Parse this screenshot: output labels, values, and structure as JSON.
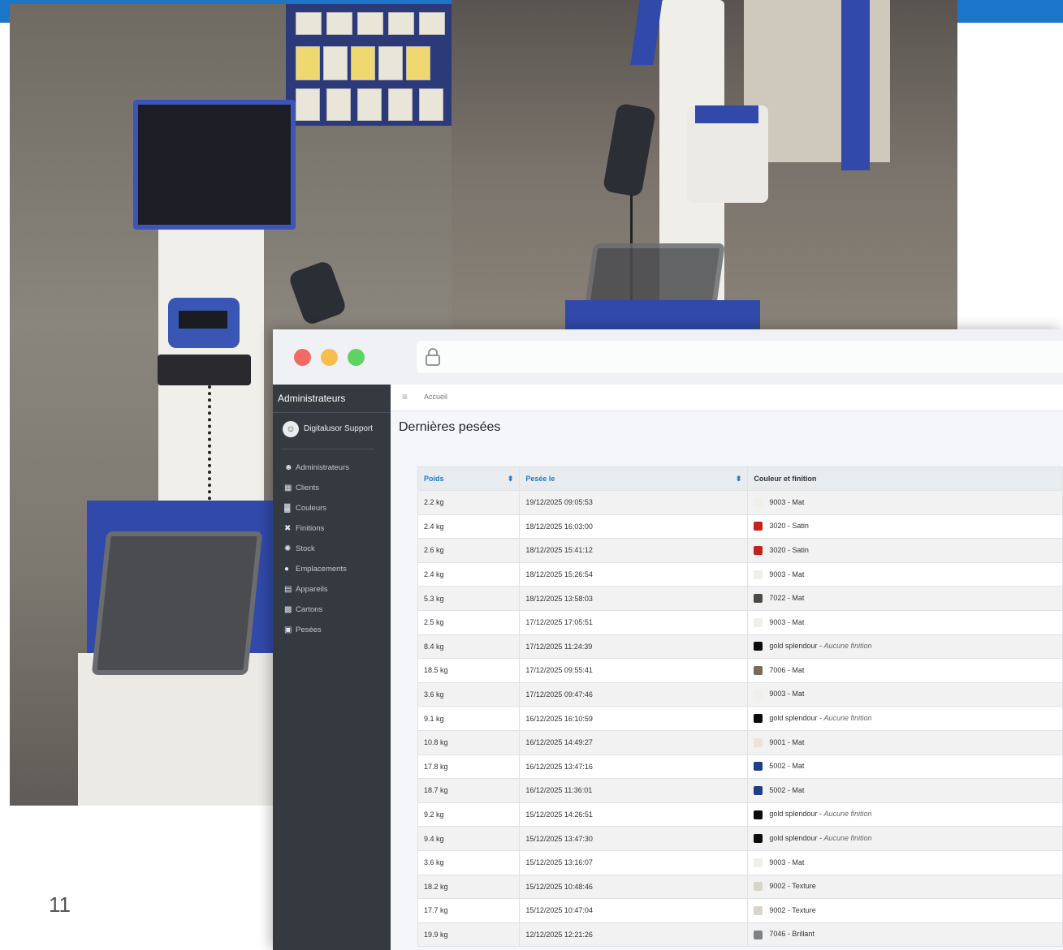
{
  "slide": {
    "number": "11"
  },
  "browser": {
    "sidebar": {
      "brand": "Administrateurs",
      "user": "Digitalusor Support",
      "items": [
        {
          "label": "Administrateurs",
          "icon": "users-icon"
        },
        {
          "label": "Clients",
          "icon": "building-icon"
        },
        {
          "label": "Couleurs",
          "icon": "palette-swatch-icon"
        },
        {
          "label": "Finitions",
          "icon": "tools-icon"
        },
        {
          "label": "Stock",
          "icon": "palette-icon"
        },
        {
          "label": "Emplacements",
          "icon": "map-marker-icon"
        },
        {
          "label": "Appareils",
          "icon": "device-icon"
        },
        {
          "label": "Cartons",
          "icon": "boxes-icon"
        },
        {
          "label": "Pesées",
          "icon": "scale-icon"
        }
      ]
    },
    "breadcrumb": "Accueil",
    "page_title": "Dernières pesées",
    "table": {
      "headers": [
        "Poids",
        "Pesée le",
        "Couleur et finition"
      ],
      "rows": [
        {
          "poids": "2.2 kg",
          "date": "19/12/2025 09:05:53",
          "color": "9003 - Mat",
          "swatch": "#f0efea",
          "note": ""
        },
        {
          "poids": "2.4 kg",
          "date": "18/12/2025 16:03:00",
          "color": "3020 - Satin",
          "swatch": "#c7211f",
          "note": ""
        },
        {
          "poids": "2.6 kg",
          "date": "18/12/2025 15:41:12",
          "color": "3020 - Satin",
          "swatch": "#c7211f",
          "note": ""
        },
        {
          "poids": "2.4 kg",
          "date": "18/12/2025 15:26:54",
          "color": "9003 - Mat",
          "swatch": "#f0efea",
          "note": ""
        },
        {
          "poids": "5.3 kg",
          "date": "18/12/2025 13:58:03",
          "color": "7022 - Mat",
          "swatch": "#4c4a45",
          "note": ""
        },
        {
          "poids": "2.5 kg",
          "date": "17/12/2025 17:05:51",
          "color": "9003 - Mat",
          "swatch": "#f0efea",
          "note": ""
        },
        {
          "poids": "8.4 kg",
          "date": "17/12/2025 11:24:39",
          "color": "gold splendour",
          "swatch": "#0b0b0b",
          "note": "Aucune finition"
        },
        {
          "poids": "18.5 kg",
          "date": "17/12/2025 09:55:41",
          "color": "7006 - Mat",
          "swatch": "#7a6a5c",
          "note": ""
        },
        {
          "poids": "3.6 kg",
          "date": "17/12/2025 09:47:46",
          "color": "9003 - Mat",
          "swatch": "#f0efea",
          "note": ""
        },
        {
          "poids": "9.1 kg",
          "date": "16/12/2025 16:10:59",
          "color": "gold splendour",
          "swatch": "#0b0b0b",
          "note": "Aucune finition"
        },
        {
          "poids": "10.8 kg",
          "date": "16/12/2025 14:49:27",
          "color": "9001 - Mat",
          "swatch": "#ece3d6",
          "note": ""
        },
        {
          "poids": "17.8 kg",
          "date": "16/12/2025 13:47:16",
          "color": "5002 - Mat",
          "swatch": "#1e3f85",
          "note": ""
        },
        {
          "poids": "18.7 kg",
          "date": "16/12/2025 11:36:01",
          "color": "5002 - Mat",
          "swatch": "#1e3f85",
          "note": ""
        },
        {
          "poids": "9.2 kg",
          "date": "15/12/2025 14:26:51",
          "color": "gold splendour",
          "swatch": "#0b0b0b",
          "note": "Aucune finition"
        },
        {
          "poids": "9.4 kg",
          "date": "15/12/2025 13:47:30",
          "color": "gold splendour",
          "swatch": "#0b0b0b",
          "note": "Aucune finition"
        },
        {
          "poids": "3.6 kg",
          "date": "15/12/2025 13:16:07",
          "color": "9003 - Mat",
          "swatch": "#f0efea",
          "note": ""
        },
        {
          "poids": "18.2 kg",
          "date": "15/12/2025 10:48:46",
          "color": "9002 - Texture",
          "swatch": "#d7d5cb",
          "note": ""
        },
        {
          "poids": "17.7 kg",
          "date": "15/12/2025 10:47:04",
          "color": "9002 - Texture",
          "swatch": "#d7d5cb",
          "note": ""
        },
        {
          "poids": "19.9 kg",
          "date": "12/12/2025 12:21:26",
          "color": "7046 - Brillant",
          "swatch": "#7d8287",
          "note": ""
        }
      ]
    }
  }
}
